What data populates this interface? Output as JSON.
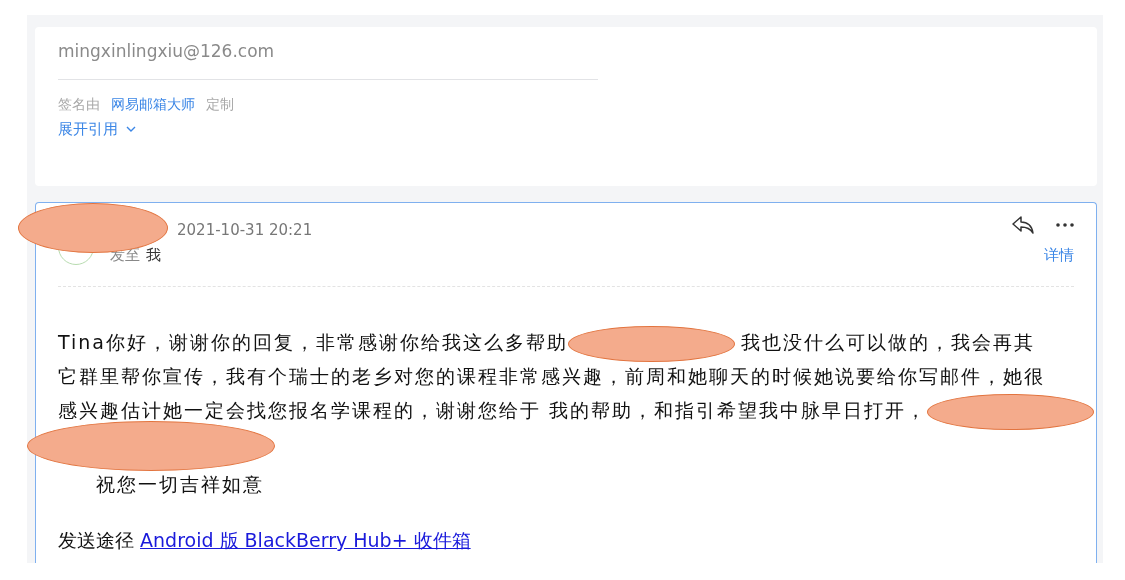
{
  "quoted_card": {
    "email": "mingxinlingxiu@126.com",
    "signature": {
      "prefix": "签名由",
      "link": "网易邮箱大师",
      "suffix": "定制"
    },
    "expand_quote": "展开引用"
  },
  "message": {
    "date": "2021-10-31 20:21",
    "recipient_label": "发至",
    "recipient": "我",
    "details_link": "详情",
    "body_lines": [
      {
        "segments": [
          {
            "kind": "text",
            "text": "Tina你好，谢谢你的回复，非常感谢你给我这么多帮助"
          },
          {
            "kind": "redaction"
          },
          {
            "kind": "text",
            "text": "我也没什么可以做的，我会再其"
          }
        ]
      },
      {
        "segments": [
          {
            "kind": "text",
            "text": "它群里帮你宣传，我有个瑞士的老乡对您的课程非常感兴趣，前周和她聊天的时候她说要给你写邮件，她很"
          }
        ]
      },
      {
        "segments": [
          {
            "kind": "text",
            "text": "感兴趣估计她一定会找您报名学课程的，谢谢您给于 我的帮助，和指引希望我中脉早日打开，"
          },
          {
            "kind": "redaction"
          }
        ]
      },
      {
        "segments": [
          {
            "kind": "redaction"
          }
        ]
      }
    ],
    "closing": "祝您一切吉祥如意",
    "sent_via": {
      "label": "发送途径",
      "link": "Android 版 BlackBerry Hub+ 收件箱"
    }
  }
}
